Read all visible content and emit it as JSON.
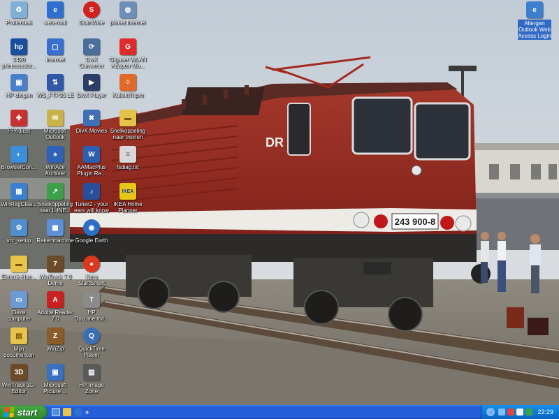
{
  "desktop": {
    "icons": [
      {
        "label": "Prullenbak",
        "icon": "recycle-bin-icon",
        "color": "#7fb0d8"
      },
      {
        "label": "web-mail",
        "icon": "internet-explorer-icon",
        "color": "#2e6fd1"
      },
      {
        "label": "ScanWise",
        "icon": "scanwise-icon",
        "color": "#d62020"
      },
      {
        "label": "planet internet",
        "icon": "planet-internet-icon",
        "color": "#6e8fb5"
      },
      {
        "label": "3420 printerassist...",
        "icon": "hp-icon",
        "color": "#1a4fa0"
      },
      {
        "label": "Internet",
        "icon": "internet-window-icon",
        "color": "#3a6fcf"
      },
      {
        "label": "DivX Converter",
        "icon": "divx-converter-icon",
        "color": "#4b6f9a"
      },
      {
        "label": "Gigaset WLAN Adapter Mo...",
        "icon": "gigaset-icon",
        "color": "#e02b2b"
      },
      {
        "label": "HP-dingen",
        "icon": "hp-folder-icon",
        "color": "#4a7fcc"
      },
      {
        "label": "WS_FTP95 LE",
        "icon": "ftp-icon",
        "color": "#3057a8"
      },
      {
        "label": "DivX Player",
        "icon": "divx-player-icon",
        "color": "#2b3f66"
      },
      {
        "label": "KollektTripro",
        "icon": "grid-app-icon",
        "color": "#e06a2a"
      },
      {
        "label": "PPAdjust",
        "icon": "ppadjust-icon",
        "color": "#c83232"
      },
      {
        "label": "Microsoft Outlook",
        "icon": "outlook-icon",
        "color": "#c9b24a"
      },
      {
        "label": "DivX Movies",
        "icon": "divx-movies-icon",
        "color": "#3f70b6"
      },
      {
        "label": "Snelkoppeling naar treinen",
        "icon": "folder-shortcut-icon",
        "color": "#e5c24a"
      },
      {
        "label": "BrowserCon...",
        "icon": "browser-icon",
        "color": "#3a8fd8"
      },
      {
        "label": "WinAce Archiver",
        "icon": "winace-icon",
        "color": "#2d62b8"
      },
      {
        "label": "AAMacPlus Plugin Re...",
        "icon": "word-document-icon",
        "color": "#2b5fb0"
      },
      {
        "label": "fsdiag.txt",
        "icon": "text-file-icon",
        "color": "#d8d8d8"
      },
      {
        "label": "WinRegClea...",
        "icon": "registry-cleaner-icon",
        "color": "#3a7fd0"
      },
      {
        "label": "Snelkoppeling naar L-INE...",
        "icon": "shortcut-icon",
        "color": "#3ca04a"
      },
      {
        "label": "Tuner2 - your ears will know",
        "icon": "tuner-icon",
        "color": "#2a4f9a"
      },
      {
        "label": "IKEA Home Planner",
        "icon": "ikea-icon",
        "color": "#e5c817"
      },
      {
        "label": "vrc_setup",
        "icon": "setup-icon",
        "color": "#4f8ed0"
      },
      {
        "label": "Rekenmachine",
        "icon": "calculator-icon",
        "color": "#5b8fd6"
      },
      {
        "label": "Google Earth",
        "icon": "google-earth-icon",
        "color": "#2b6fc4"
      },
      {
        "label": "Elektrik-Han...",
        "icon": "folder-icon",
        "color": "#e8c34c"
      },
      {
        "label": "WinTrack 7.0 Demo",
        "icon": "wintrack-icon",
        "color": "#6b4a2a"
      },
      {
        "label": "Nero StartSmart",
        "icon": "nero-icon",
        "color": "#d93a1f"
      },
      {
        "label": "Deze computer",
        "icon": "my-computer-icon",
        "color": "#6c9ad4"
      },
      {
        "label": "Adobe Reader 7.0",
        "icon": "adobe-reader-icon",
        "color": "#c92020"
      },
      {
        "label": "HP Documentvi...",
        "icon": "hp-document-icon",
        "color": "#8a8a8a"
      },
      {
        "label": "Mijn documenten",
        "icon": "my-documents-icon",
        "color": "#e8c34c"
      },
      {
        "label": "WinZip",
        "icon": "winzip-icon",
        "color": "#8a5c2a"
      },
      {
        "label": "QuickTime Player",
        "icon": "quicktime-icon",
        "color": "#3a6fb8"
      },
      {
        "label": "WinTrack 3D-Editor",
        "icon": "wintrack-3d-icon",
        "color": "#6b4a2a"
      },
      {
        "label": "Microsoft Picture ...",
        "icon": "picture-manager-icon",
        "color": "#3a70c0"
      },
      {
        "label": "HP Image Zone",
        "icon": "hp-image-zone-icon",
        "color": "#5a5a5a"
      },
      {
        "label": "Allergan Outlook Web Access Login",
        "icon": "outlook-web-access-icon",
        "color": "#3b7fd0"
      }
    ],
    "locomotive_number": "243 900-8",
    "locomotive_mark": "DR"
  },
  "taskbar": {
    "start_label": "start",
    "more_label": "»",
    "clock": "22:29",
    "start_color": "#3a9b3a",
    "bar_color": "#245edb"
  }
}
